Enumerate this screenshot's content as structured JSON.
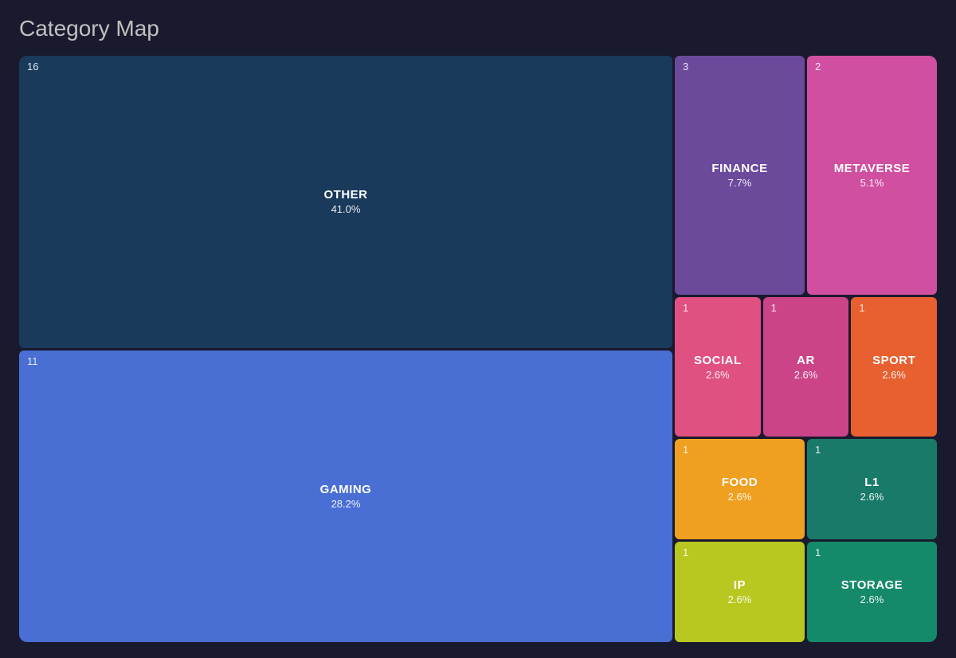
{
  "title": "Category Map",
  "cells": {
    "other": {
      "number": "16",
      "label": "OTHER",
      "pct": "41.0%"
    },
    "gaming": {
      "number": "11",
      "label": "GAMING",
      "pct": "28.2%"
    },
    "finance": {
      "number": "3",
      "label": "FINANCE",
      "pct": "7.7%"
    },
    "metaverse": {
      "number": "2",
      "label": "METAVERSE",
      "pct": "5.1%"
    },
    "social": {
      "number": "1",
      "label": "SOCIAL",
      "pct": "2.6%"
    },
    "ar": {
      "number": "1",
      "label": "AR",
      "pct": "2.6%"
    },
    "sport": {
      "number": "1",
      "label": "SPORT",
      "pct": "2.6%"
    },
    "food": {
      "number": "1",
      "label": "FOOD",
      "pct": "2.6%"
    },
    "ip": {
      "number": "1",
      "label": "IP",
      "pct": "2.6%"
    },
    "l1": {
      "number": "1",
      "label": "L1",
      "pct": "2.6%"
    },
    "storage": {
      "number": "1",
      "label": "STORAGE",
      "pct": "2.6%"
    }
  }
}
